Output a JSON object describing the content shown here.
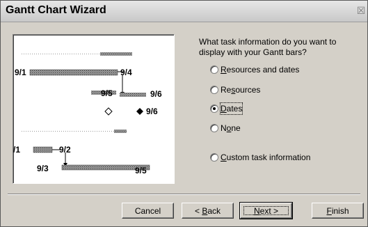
{
  "window": {
    "title": "Gantt Chart Wizard",
    "close_glyph": "☒"
  },
  "preview": {
    "labels": [
      "9/1",
      "9/4",
      "9/5",
      "9/6",
      "9/6",
      "/1",
      "9/2",
      "9/3",
      "9/5"
    ]
  },
  "question": "What task information do you want to display with your Gantt bars?",
  "options": [
    {
      "pre": "",
      "mn": "R",
      "post": "esources and dates",
      "selected": false
    },
    {
      "pre": "Re",
      "mn": "s",
      "post": "ources",
      "selected": false
    },
    {
      "pre": "",
      "mn": "D",
      "post": "ates",
      "selected": true
    },
    {
      "pre": "N",
      "mn": "o",
      "post": "ne",
      "selected": false
    },
    {
      "pre": "",
      "mn": "C",
      "post": "ustom task information",
      "selected": false
    }
  ],
  "buttons": {
    "cancel": "Cancel",
    "back": {
      "pre": "< ",
      "mn": "B",
      "post": "ack"
    },
    "next": {
      "pre": "",
      "mn": "N",
      "post": "ext >"
    },
    "finish": {
      "pre": "",
      "mn": "F",
      "post": "inish"
    }
  }
}
